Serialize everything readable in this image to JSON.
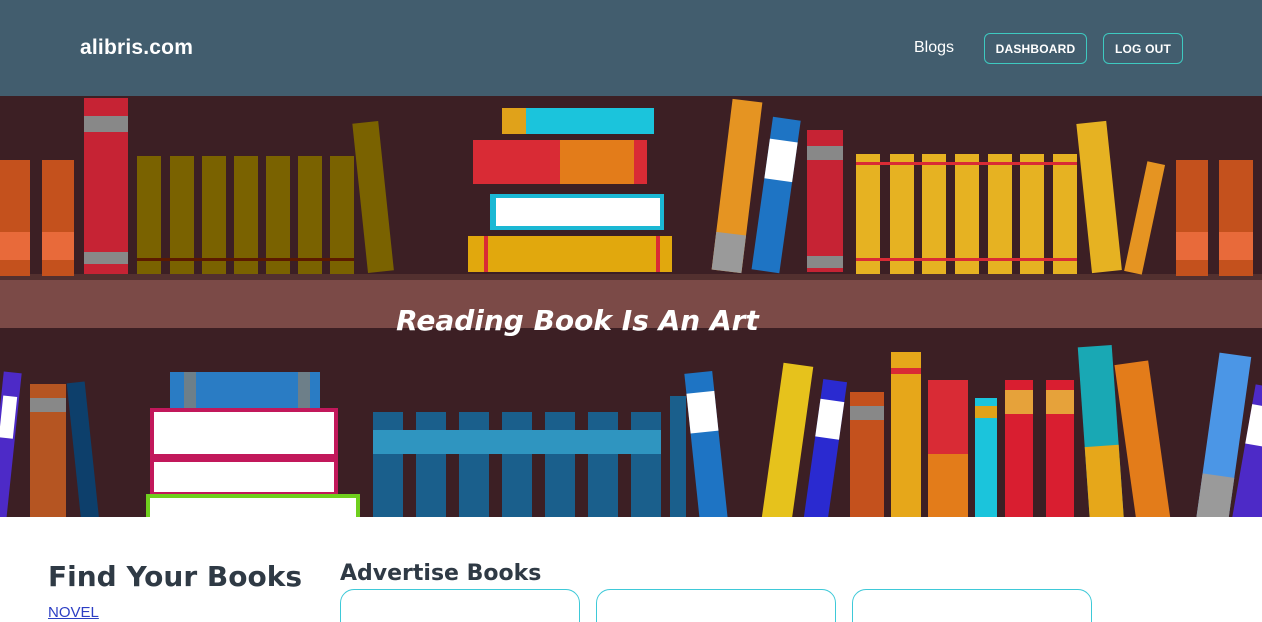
{
  "navbar": {
    "brand": "alibris.com",
    "blogs_label": "Blogs",
    "dashboard_label": "DASHBOARD",
    "logout_label": "LOG OUT"
  },
  "hero": {
    "title": "Reading Book Is An Art",
    "colors": {
      "wall": "#3c1f24",
      "shelf": "#7b4a47"
    }
  },
  "sidebar": {
    "title": "Find Your Books",
    "categories": [
      "NOVEL"
    ]
  },
  "advertise": {
    "title": "Advertise Books",
    "card_count": 3
  },
  "colors": {
    "navbar": "#425d6e",
    "accent": "#3ec9c0",
    "link": "#2c3ec4"
  }
}
